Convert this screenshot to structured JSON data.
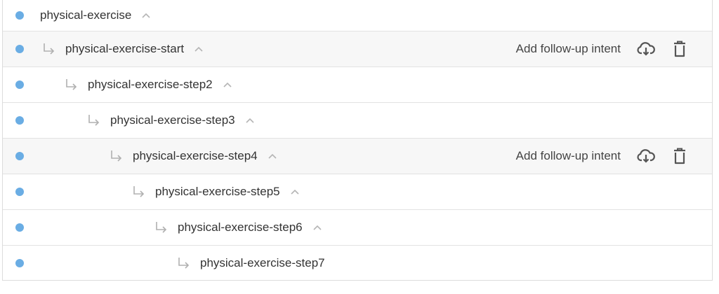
{
  "intents": [
    {
      "name": "physical-exercise",
      "level": 0,
      "is_child": false,
      "show_chevron": true,
      "show_actions": false
    },
    {
      "name": "physical-exercise-start",
      "level": 0,
      "is_child": true,
      "show_chevron": true,
      "show_actions": true
    },
    {
      "name": "physical-exercise-step2",
      "level": 1,
      "is_child": true,
      "show_chevron": true,
      "show_actions": false
    },
    {
      "name": "physical-exercise-step3",
      "level": 2,
      "is_child": true,
      "show_chevron": true,
      "show_actions": false
    },
    {
      "name": "physical-exercise-step4",
      "level": 3,
      "is_child": true,
      "show_chevron": true,
      "show_actions": true
    },
    {
      "name": "physical-exercise-step5",
      "level": 4,
      "is_child": true,
      "show_chevron": true,
      "show_actions": false
    },
    {
      "name": "physical-exercise-step6",
      "level": 5,
      "is_child": true,
      "show_chevron": true,
      "show_actions": false
    },
    {
      "name": "physical-exercise-step7",
      "level": 6,
      "is_child": true,
      "show_chevron": false,
      "show_actions": false
    }
  ],
  "actions": {
    "add_followup_label": "Add follow-up intent",
    "download_icon": "cloud-download-icon",
    "delete_icon": "trash-icon"
  },
  "icons": {
    "status_dot": "status-dot-icon",
    "child_arrow": "subdirectory-arrow-icon",
    "expand": "chevron-up-icon"
  },
  "colors": {
    "dot": "#6aade4",
    "text": "#333333",
    "muted_icon": "#b5b5b5",
    "action_icon": "#555555",
    "row_highlight": "#f7f7f7"
  }
}
